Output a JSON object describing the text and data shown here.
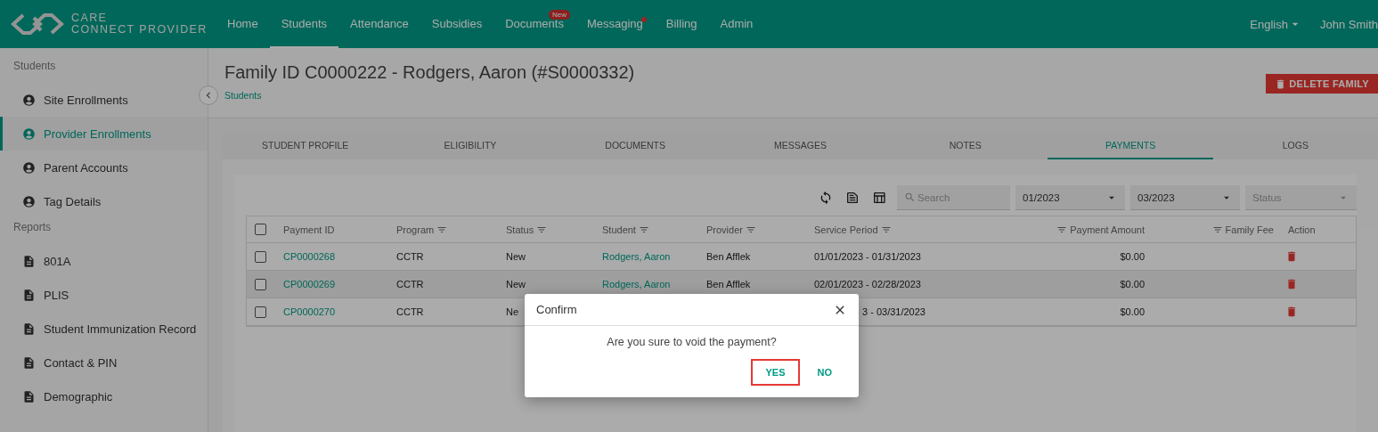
{
  "header": {
    "logo": {
      "line1": "CARE",
      "line2": "CONNECT PROVIDER"
    },
    "nav": [
      {
        "label": "Home",
        "selected": false
      },
      {
        "label": "Students",
        "selected": true
      },
      {
        "label": "Attendance",
        "selected": false
      },
      {
        "label": "Subsidies",
        "selected": false
      },
      {
        "label": "Documents",
        "selected": false,
        "badge": "New"
      },
      {
        "label": "Messaging",
        "selected": false,
        "dot": true
      },
      {
        "label": "Billing",
        "selected": false
      },
      {
        "label": "Admin",
        "selected": false
      }
    ],
    "language": "English",
    "user": "John Smith"
  },
  "sidebar": {
    "sections": [
      {
        "title": "Students",
        "items": [
          {
            "label": "Site Enrollments",
            "kind": "person",
            "selected": false
          },
          {
            "label": "Provider Enrollments",
            "kind": "person",
            "selected": true
          },
          {
            "label": "Parent Accounts",
            "kind": "person",
            "selected": false
          },
          {
            "label": "Tag Details",
            "kind": "person",
            "selected": false
          }
        ]
      },
      {
        "title": "Reports",
        "items": [
          {
            "label": "801A",
            "kind": "document",
            "selected": false
          },
          {
            "label": "PLIS",
            "kind": "document",
            "selected": false
          },
          {
            "label": "Student Immunization Record",
            "kind": "document",
            "selected": false
          },
          {
            "label": "Contact & PIN",
            "kind": "document",
            "selected": false
          },
          {
            "label": "Demographic",
            "kind": "document",
            "selected": false
          }
        ]
      }
    ]
  },
  "page": {
    "title": "Family ID C0000222 - Rodgers, Aaron (#S0000332)",
    "breadcrumb": "Students",
    "delete_button": "DELETE FAMILY"
  },
  "tabs": [
    {
      "label": "STUDENT PROFILE",
      "selected": false
    },
    {
      "label": "ELIGIBILITY",
      "selected": false
    },
    {
      "label": "DOCUMENTS",
      "selected": false
    },
    {
      "label": "MESSAGES",
      "selected": false
    },
    {
      "label": "NOTES",
      "selected": false
    },
    {
      "label": "PAYMENTS",
      "selected": true
    },
    {
      "label": "LOGS",
      "selected": false
    }
  ],
  "toolbar": {
    "search": {
      "placeholder": "Search"
    },
    "from": "01/2023",
    "to": "03/2023",
    "status": {
      "placeholder": "Status"
    }
  },
  "table": {
    "all_checked": false,
    "columns": [
      {
        "label": "Payment ID",
        "filter": false,
        "kind": "text"
      },
      {
        "label": "Program",
        "filter": true,
        "kind": "text"
      },
      {
        "label": "Status",
        "filter": true,
        "kind": "text"
      },
      {
        "label": "Student",
        "filter": true,
        "kind": "text"
      },
      {
        "label": "Provider",
        "filter": true,
        "kind": "text"
      },
      {
        "label": "Service Period",
        "filter": true,
        "kind": "text"
      },
      {
        "label": "Payment Amount",
        "filter": true,
        "kind": "amount"
      },
      {
        "label": "Family Fee",
        "filter": true,
        "kind": "amount"
      },
      {
        "label": "Action",
        "filter": false,
        "kind": "text"
      }
    ],
    "rows": [
      {
        "kind": "full",
        "checked": false,
        "highlighted": false,
        "payment_id": "CP0000268",
        "program": "CCTR",
        "status": "New",
        "student": "Rodgers, Aaron",
        "provider": "Ben Afflek",
        "service_period": "01/01/2023 - 01/31/2023",
        "payment_amount": "$0.00"
      },
      {
        "kind": "full",
        "checked": false,
        "highlighted": true,
        "payment_id": "CP0000269",
        "program": "CCTR",
        "status": "New",
        "student": "Rodgers, Aaron",
        "provider": "Ben Afflek",
        "service_period": "02/01/2023 - 02/28/2023",
        "payment_amount": "$0.00"
      },
      {
        "kind": "covered",
        "checked": false,
        "highlighted": false,
        "payment_id": "CP0000270",
        "program": "CCTR",
        "status": "Ne",
        "service_period": "3 - 03/31/2023",
        "payment_amount": "$0.00"
      }
    ]
  },
  "dialog": {
    "title": "Confirm",
    "message": "Are you sure to void the payment?",
    "buttons": [
      {
        "label": "YES",
        "highlighted": true
      },
      {
        "label": "NO",
        "highlighted": false
      }
    ]
  }
}
